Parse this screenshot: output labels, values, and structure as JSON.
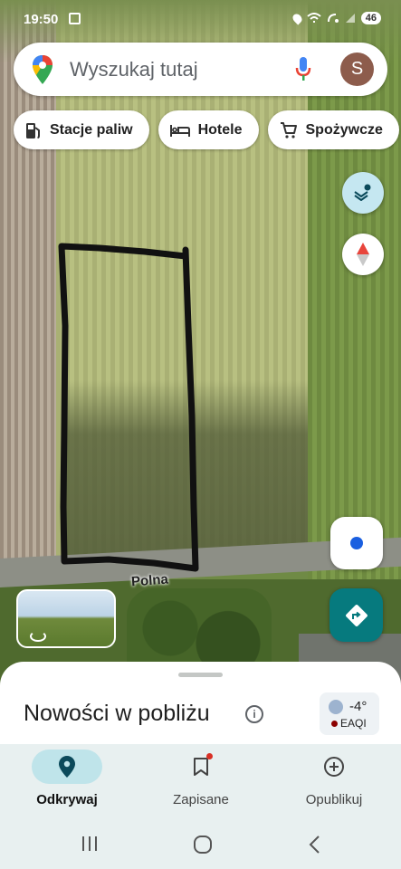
{
  "status_bar": {
    "time": "19:50",
    "battery": "46"
  },
  "search": {
    "placeholder": "Wyszukaj tutaj",
    "avatar_initial": "S"
  },
  "chips": [
    {
      "label": "Stacje paliw",
      "icon": "fuel-icon"
    },
    {
      "label": "Hotele",
      "icon": "bed-icon"
    },
    {
      "label": "Spożywcze",
      "icon": "cart-icon"
    }
  ],
  "map": {
    "road_label": "Polna"
  },
  "sheet": {
    "title": "Nowości w pobliżu",
    "weather_temp": "-4°",
    "weather_aqi": "EAQI"
  },
  "nav": [
    {
      "label": "Odkrywaj",
      "icon": "explore-pin-icon",
      "active": true
    },
    {
      "label": "Zapisane",
      "icon": "bookmark-icon",
      "active": false
    },
    {
      "label": "Opublikuj",
      "icon": "add-circle-icon",
      "active": false
    }
  ],
  "colors": {
    "accent": "#067a7e",
    "active_nav": "#bfe4ea",
    "location_blue": "#1a5fe0"
  }
}
